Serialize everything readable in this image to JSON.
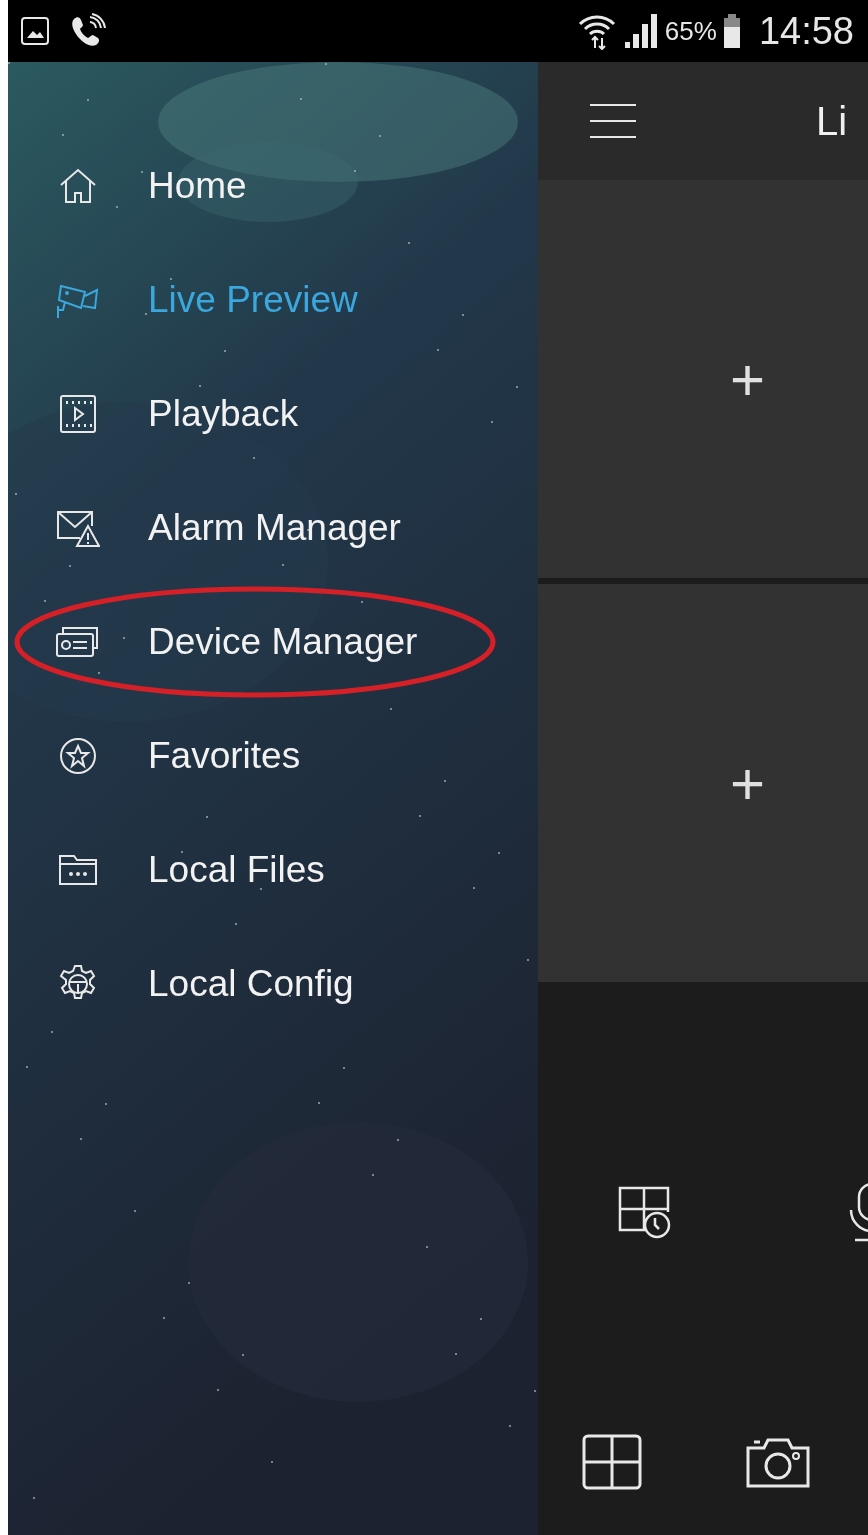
{
  "status_bar": {
    "battery": "65%",
    "time": "14:58"
  },
  "drawer": {
    "items": [
      {
        "label": "Home",
        "selected": false,
        "circled": false
      },
      {
        "label": "Live Preview",
        "selected": true,
        "circled": false
      },
      {
        "label": "Playback",
        "selected": false,
        "circled": false
      },
      {
        "label": "Alarm Manager",
        "selected": false,
        "circled": false
      },
      {
        "label": "Device Manager",
        "selected": false,
        "circled": true
      },
      {
        "label": "Favorites",
        "selected": false,
        "circled": false
      },
      {
        "label": "Local Files",
        "selected": false,
        "circled": false
      },
      {
        "label": "Local Config",
        "selected": false,
        "circled": false
      }
    ]
  },
  "header": {
    "title": "Li"
  },
  "tiles": [
    {
      "action": "+"
    },
    {
      "action": "+"
    }
  ]
}
